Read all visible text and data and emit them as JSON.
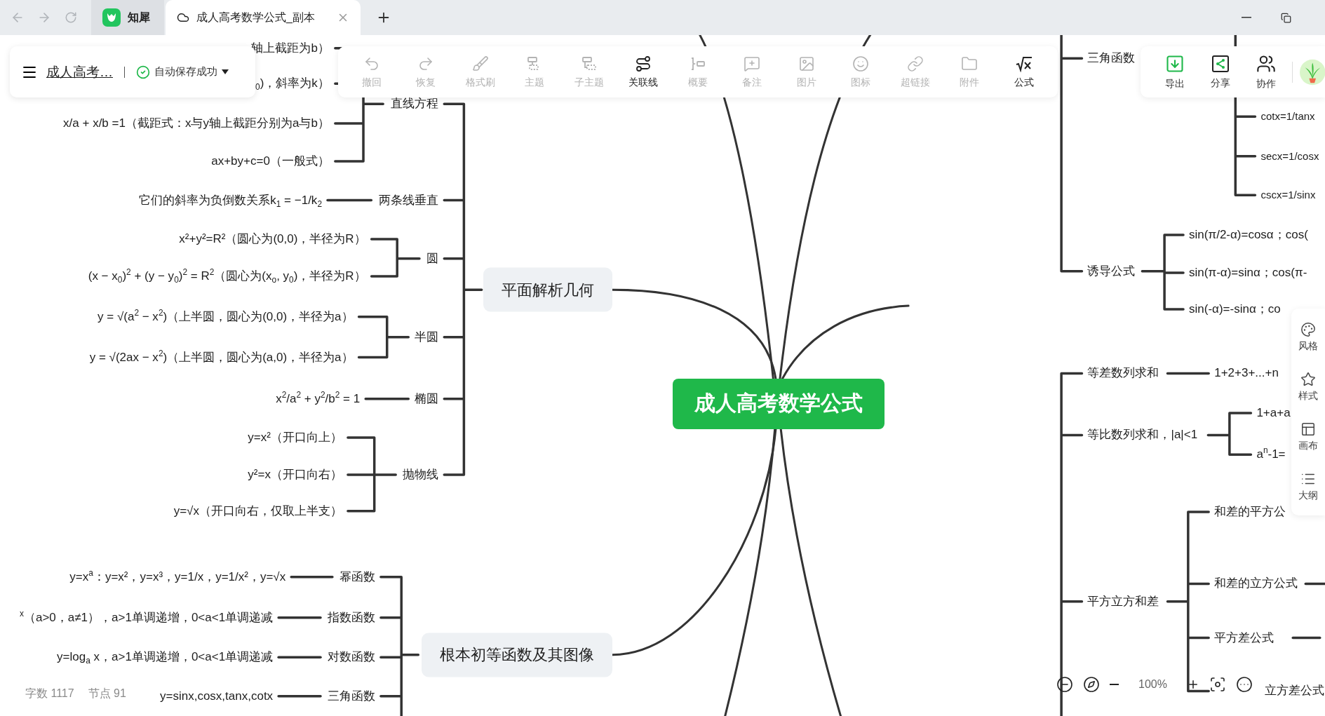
{
  "browser": {
    "tabs": [
      {
        "label": "知犀",
        "selected": false
      },
      {
        "label": "成人高考数学公式_副本",
        "selected": true
      }
    ]
  },
  "file_panel": {
    "title": "成人高考…",
    "save_status": "自动保存成功"
  },
  "toolbar": [
    {
      "label": "撤回",
      "disabled": true
    },
    {
      "label": "恢复",
      "disabled": true
    },
    {
      "label": "格式刷",
      "disabled": true
    },
    {
      "label": "主题",
      "disabled": true
    },
    {
      "label": "子主题",
      "disabled": true
    },
    {
      "label": "关联线",
      "disabled": false
    },
    {
      "label": "概要",
      "disabled": true
    },
    {
      "label": "备注",
      "disabled": true
    },
    {
      "label": "图片",
      "disabled": true
    },
    {
      "label": "图标",
      "disabled": true
    },
    {
      "label": "超链接",
      "disabled": true
    },
    {
      "label": "附件",
      "disabled": true
    },
    {
      "label": "公式",
      "disabled": false
    }
  ],
  "share_panel": [
    {
      "label": "导出"
    },
    {
      "label": "分享"
    },
    {
      "label": "协作"
    }
  ],
  "side_panel": [
    {
      "label": "风格"
    },
    {
      "label": "样式"
    },
    {
      "label": "画布"
    },
    {
      "label": "大纲"
    }
  ],
  "mind_map": {
    "root": "成人高考数学公式",
    "left_topics": [
      {
        "label": "平面解析几何",
        "children": [
          {
            "label": "直线方程",
            "children": [
              {
                "label": "轴上截距为b）"
              },
              {
                "label": "$_{0}$)，斜率为k）"
              },
              {
                "label": "x/a + x/b =1（截距式：x与y轴上截距分别为a与b）"
              },
              {
                "label": "ax+by+c=0（一般式）"
              }
            ]
          },
          {
            "label": "两条线垂直",
            "children": [
              {
                "label": "它们的斜率为负倒数关系k$_{1}$ = −1/k$_{2}$"
              }
            ]
          },
          {
            "label": "圆",
            "children": [
              {
                "label": "x²+y²=R²（圆心为(0,0)，半径为R）"
              },
              {
                "label": "(x − x$_{0}$)$^{2}$ + (y − y$_{0}$)$^{2}$ = R$^{2}$（圆心为(x$_{o}$, y$_{0}$)，半径为R）"
              }
            ]
          },
          {
            "label": "半圆",
            "children": [
              {
                "label": "y = √(a$^{2}$ − x$^{2}$)（上半圆，圆心为(0,0)，半径为a）"
              },
              {
                "label": "y = √(2ax − x$^{2}$)（上半圆，圆心为(a,0)，半径为a）"
              }
            ]
          },
          {
            "label": "椭圆",
            "children": [
              {
                "label": "x$^{2}$/a$^{2}$ + y$^{2}$/b$^{2}$ = 1"
              }
            ]
          },
          {
            "label": "抛物线",
            "children": [
              {
                "label": "y=x²（开口向上）"
              },
              {
                "label": "y²=x（开口向右）"
              },
              {
                "label": "y=√x（开口向右，仅取上半支）"
              }
            ]
          }
        ]
      },
      {
        "label": "根本初等函数及其图像",
        "children": [
          {
            "label": "幂函数",
            "children": [
              {
                "label": "y=x$^{a}$：y=x²，y=x³，y=1/x，y=1/x²，y=√x"
              }
            ]
          },
          {
            "label": "指数函数",
            "children": [
              {
                "label": "$^{x}$（a>0，a≠1），a>1单调递增，0<a<1单调递减"
              }
            ]
          },
          {
            "label": "对数函数",
            "children": [
              {
                "label": "y=log$_{a}$ x，a>1单调递增，0<a<1单调递减"
              }
            ]
          },
          {
            "label": "三角函数",
            "children": [
              {
                "label": "y=sinx,cosx,tanx,cotx"
              }
            ]
          }
        ]
      }
    ],
    "right_groups": [
      {
        "topics": [
          {
            "label": "三角函数",
            "children": [
              {
                "label": "cotx=1/tanx"
              },
              {
                "label": "secx=1/cosx"
              },
              {
                "label": "cscx=1/sinx"
              }
            ]
          },
          {
            "label": "诱导公式",
            "children": [
              {
                "label": "sin(π/2-α)=cosα；cos("
              },
              {
                "label": "sin(π-α)=sinα；cos(π-"
              },
              {
                "label": "sin(-α)=-sinα；co"
              }
            ]
          }
        ]
      },
      {
        "topics": [
          {
            "label": "等差数列求和",
            "children": [
              {
                "label": "1+2+3+...+n"
              }
            ]
          },
          {
            "label": "等比数列求和，|a|<1",
            "children": [
              {
                "label": "1+a+a"
              },
              {
                "label": "a$^{n}$-1="
              }
            ]
          },
          {
            "label": "平方立方和差",
            "children": [
              {
                "label": "和差的平方公"
              },
              {
                "label": "和差的立方公式"
              },
              {
                "label": "平方差公式"
              },
              {
                "label": "立方差公式"
              }
            ]
          }
        ]
      }
    ]
  },
  "status": {
    "word_count": "字数 1117",
    "node_count": "节点 91"
  },
  "zoom_bar": {
    "zoom": "100%"
  }
}
